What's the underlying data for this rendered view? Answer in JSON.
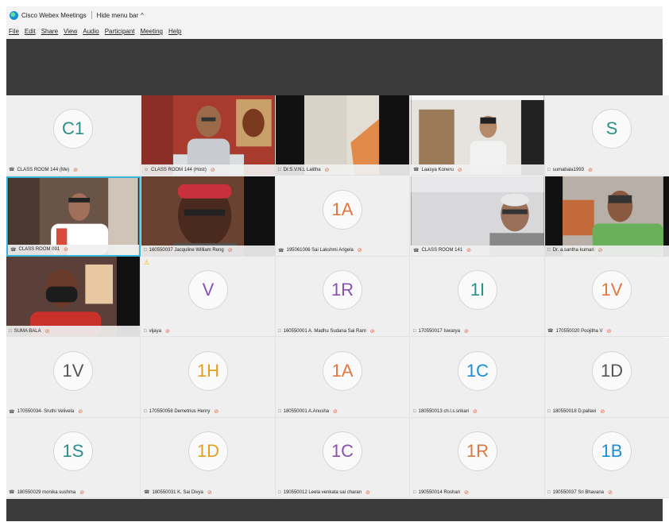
{
  "titlebar": {
    "app_title": "Cisco Webex Meetings",
    "hide_menu_label": "Hide menu bar",
    "chevron": "^"
  },
  "menu": [
    "File",
    "Edit",
    "Share",
    "View",
    "Audio",
    "Participant",
    "Meeting",
    "Help"
  ],
  "icons": {
    "app_logo": "webex-logo-icon",
    "device": "device-icon",
    "mute": "muted-microphone-icon",
    "warning": "warning-icon"
  },
  "colors": {
    "stage_strip": "#3b3b3b",
    "tile_bg": "#efefef",
    "active_border": "#36b5d8",
    "mute_icon": "#e06040",
    "warning": "#e6b400"
  },
  "participants": [
    {
      "name": "CLASS ROOM 144 (Me)",
      "type": "avatar",
      "initials": "C1",
      "initials_color": "#2a8f8a",
      "device": "phone-icon"
    },
    {
      "name": "CLASS ROOM 144 (Host)",
      "type": "video",
      "scene": "man-red-wall",
      "device": "people-icon"
    },
    {
      "name": "Dr.S.V.N.L Lalitha",
      "type": "video",
      "scene": "white-wall",
      "device": "computer-icon"
    },
    {
      "name": "Laasya Koneru",
      "type": "video",
      "scene": "girl-room",
      "device": "phone-icon"
    },
    {
      "name": "sumabala1993",
      "type": "avatar",
      "initials": "S",
      "initials_color": "#2a8f8a",
      "device": "computer-icon"
    },
    {
      "name": "CLASS ROOM 091",
      "type": "video",
      "scene": "woman-classroom",
      "device": "phone-icon",
      "active": true
    },
    {
      "name": "160550037 Jacquline William Reng",
      "type": "video",
      "scene": "woman-red-cap",
      "device": "computer-icon"
    },
    {
      "name": "195061006 Sai Lakshmi Arigela",
      "type": "avatar",
      "initials": "1A",
      "initials_color": "#e07840",
      "device": "phone-icon"
    },
    {
      "name": "CLASS ROOM 141",
      "type": "video",
      "scene": "old-man",
      "device": "phone-icon"
    },
    {
      "name": "Dr. a.santha kumari",
      "type": "video",
      "scene": "woman-saree",
      "device": "computer-icon"
    },
    {
      "name": "SUMA BALA",
      "type": "video",
      "scene": "woman-mask",
      "device": "computer-icon"
    },
    {
      "name": "vijaya",
      "type": "avatar",
      "initials": "V",
      "initials_color": "#8a4fb0",
      "device": "computer-icon",
      "warning": true
    },
    {
      "name": "160550001 A. Madhu Sudana Sai Ram",
      "type": "avatar",
      "initials": "1R",
      "initials_color": "#8a4fb0",
      "device": "computer-icon"
    },
    {
      "name": "170550017 Iswarya",
      "type": "avatar",
      "initials": "1I",
      "initials_color": "#2a8f8a",
      "device": "computer-icon"
    },
    {
      "name": "170550020 Poojitha V",
      "type": "avatar",
      "initials": "1V",
      "initials_color": "#e07840",
      "device": "phone-icon"
    },
    {
      "name": "170550034- Sruthi Velivela",
      "type": "avatar",
      "initials": "1V",
      "initials_color": "#555555",
      "device": "phone-icon"
    },
    {
      "name": "170550058 Demetrius Henry",
      "type": "avatar",
      "initials": "1H",
      "initials_color": "#e0a020",
      "device": "computer-icon"
    },
    {
      "name": "180550001 A.Anusha",
      "type": "avatar",
      "initials": "1A",
      "initials_color": "#e07840",
      "device": "computer-icon"
    },
    {
      "name": "180550013 ch.l.s.srikari",
      "type": "avatar",
      "initials": "1C",
      "initials_color": "#1a8fd8",
      "device": "computer-icon"
    },
    {
      "name": "180550018 D.pallavi",
      "type": "avatar",
      "initials": "1D",
      "initials_color": "#555555",
      "device": "computer-icon"
    },
    {
      "name": "180550029 monika sushma",
      "type": "avatar",
      "initials": "1S",
      "initials_color": "#2a8f8a",
      "device": "phone-icon"
    },
    {
      "name": "180550031 K. Sai Divya",
      "type": "avatar",
      "initials": "1D",
      "initials_color": "#e0a020",
      "device": "phone-icon"
    },
    {
      "name": "190550012 Leela venkata sai charan",
      "type": "avatar",
      "initials": "1C",
      "initials_color": "#8a4fb0",
      "device": "computer-icon"
    },
    {
      "name": "190550014 Roshan",
      "type": "avatar",
      "initials": "1R",
      "initials_color": "#e07840",
      "device": "computer-icon"
    },
    {
      "name": "190550037 Sri Bhavana",
      "type": "avatar",
      "initials": "1B",
      "initials_color": "#1a8fd8",
      "device": "computer-icon"
    }
  ]
}
